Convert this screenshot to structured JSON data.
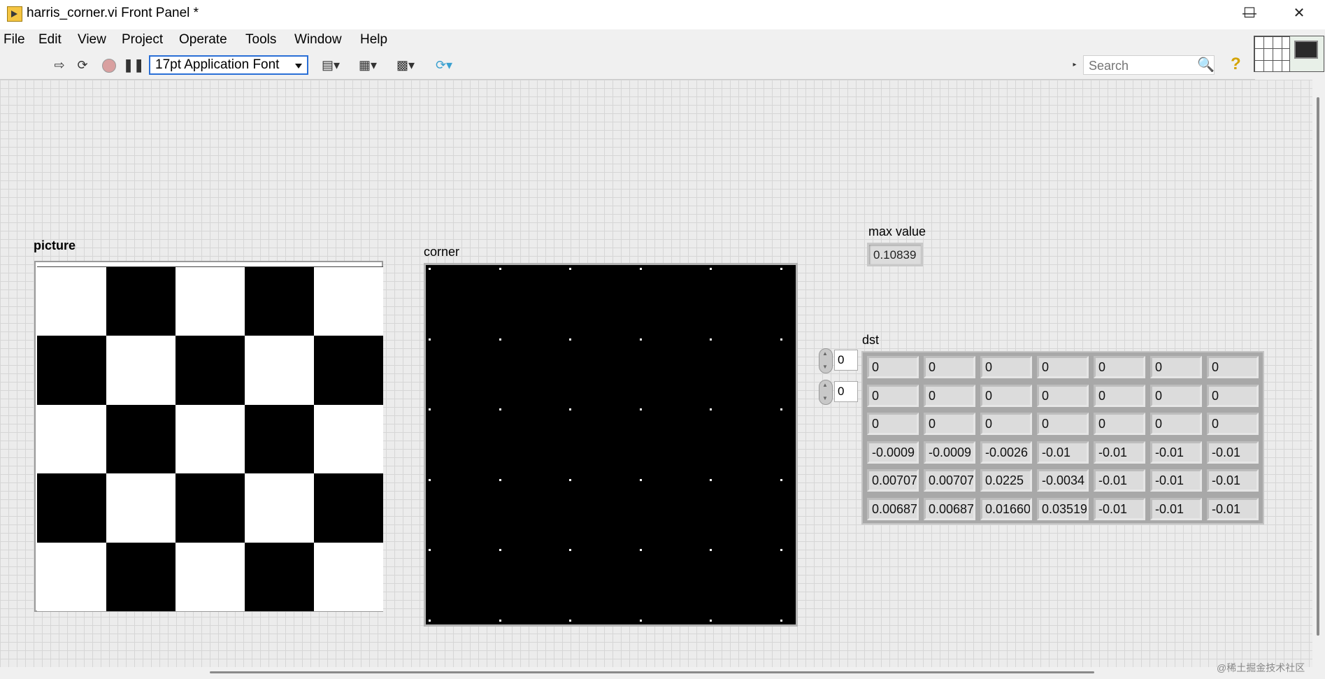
{
  "window": {
    "title": "harris_corner.vi Front Panel *"
  },
  "menu": [
    "File",
    "Edit",
    "View",
    "Project",
    "Operate",
    "Tools",
    "Window",
    "Help"
  ],
  "toolbar": {
    "font": "17pt Application Font",
    "search_placeholder": "Search"
  },
  "picture": {
    "label": "picture"
  },
  "corner": {
    "label": "corner"
  },
  "max_value": {
    "label": "max value",
    "value": "0.10839"
  },
  "dst": {
    "label": "dst",
    "index0": "0",
    "index1": "0",
    "rows": [
      [
        "0",
        "0",
        "0",
        "0",
        "0",
        "0",
        "0"
      ],
      [
        "0",
        "0",
        "0",
        "0",
        "0",
        "0",
        "0"
      ],
      [
        "0",
        "0",
        "0",
        "0",
        "0",
        "0",
        "0"
      ],
      [
        "-0.0009",
        "-0.0009",
        "-0.0026",
        "-0.01",
        "-0.01",
        "-0.01",
        "-0.01"
      ],
      [
        "0.00707",
        "0.00707",
        "0.0225",
        "-0.0034",
        "-0.01",
        "-0.01",
        "-0.01"
      ],
      [
        "0.00687",
        "0.00687",
        "0.01660",
        "0.03519",
        "-0.01",
        "-0.01",
        "-0.01"
      ]
    ]
  },
  "watermark": "@稀土掘金技术社区"
}
